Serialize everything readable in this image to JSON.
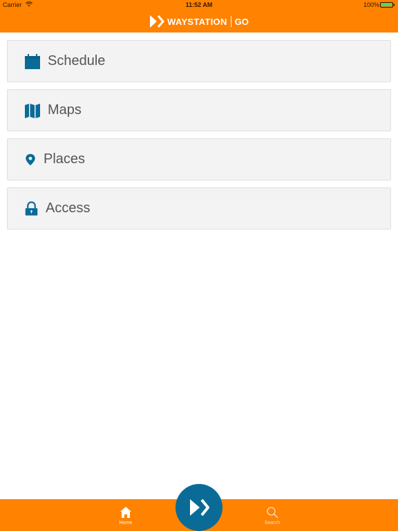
{
  "status_bar": {
    "carrier": "Carrier",
    "time": "11:52 AM",
    "battery": "100%"
  },
  "header": {
    "logo_icon": "waystation-logo-icon",
    "brand_name": "WAYSTATION",
    "brand_suffix": "GO"
  },
  "menu": {
    "items": [
      {
        "label": "Schedule",
        "icon": "calendar-icon"
      },
      {
        "label": "Maps",
        "icon": "map-icon"
      },
      {
        "label": "Places",
        "icon": "location-pin-icon"
      },
      {
        "label": "Access",
        "icon": "padlock-icon"
      }
    ]
  },
  "tabbar": {
    "home_label": "Home",
    "search_label": "Search",
    "center_icon": "waystation-logo-icon"
  },
  "colors": {
    "accent": "#ff8200",
    "icon_blue": "#0a6b97",
    "card_bg": "#f3f3f3",
    "text": "#555555"
  }
}
